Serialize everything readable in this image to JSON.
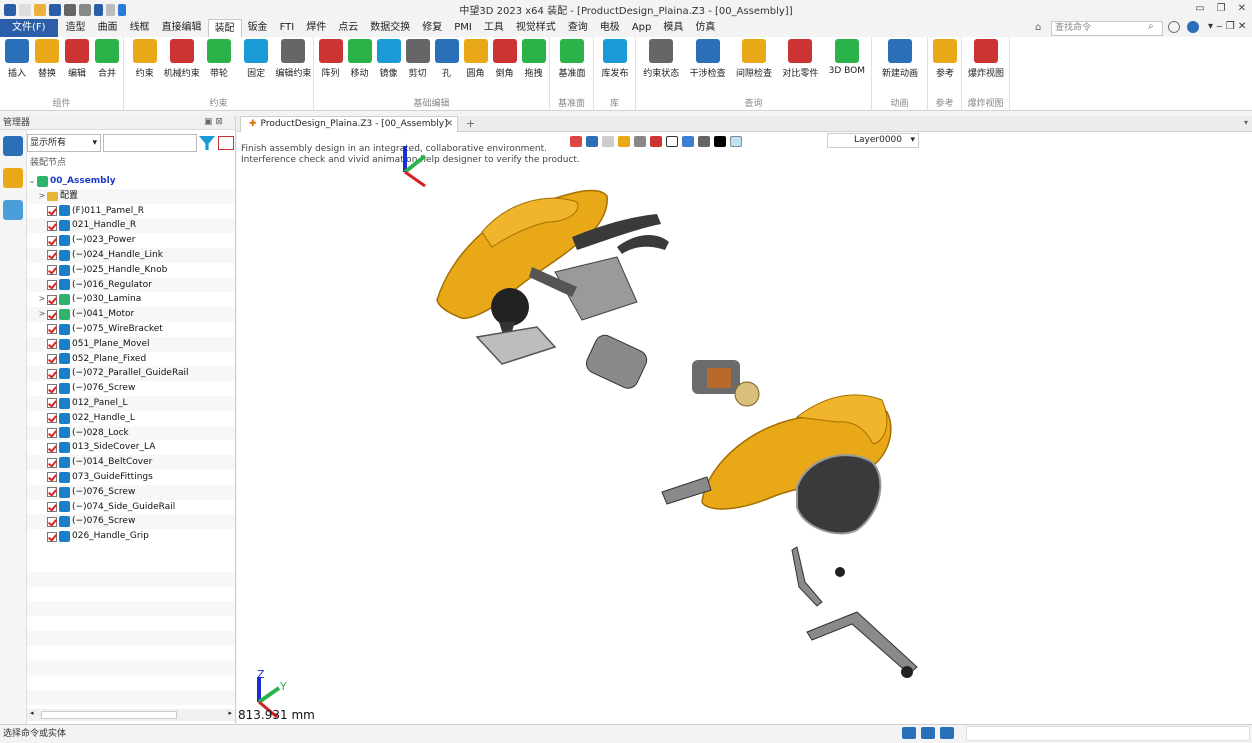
{
  "window": {
    "title": "中望3D 2023 x64          装配 - [ProductDesign_Plaina.Z3 - [00_Assembly]]"
  },
  "menubar": {
    "file": "文件(F)",
    "items": [
      "造型",
      "曲面",
      "线框",
      "直接编辑",
      "装配",
      "钣金",
      "FTI",
      "焊件",
      "点云",
      "数据交换",
      "修复",
      "PMI",
      "工具",
      "视觉样式",
      "查询",
      "电极",
      "App",
      "模具",
      "仿真"
    ],
    "active_index": 4,
    "search_placeholder": "查找命令"
  },
  "ribbon": {
    "groups": [
      {
        "label": "组件",
        "buttons": [
          "插入",
          "替换",
          "编辑",
          "合并"
        ]
      },
      {
        "label": "约束",
        "buttons": [
          "约束",
          "机械约束",
          "带轮",
          "固定",
          "编辑约束"
        ]
      },
      {
        "label": "基础编辑",
        "buttons": [
          "阵列",
          "移动",
          "镜像",
          "剪切",
          "孔",
          "圆角",
          "倒角",
          "拖拽"
        ]
      },
      {
        "label": "基准面",
        "buttons": [
          "基准面"
        ]
      },
      {
        "label": "库",
        "buttons": [
          "库发布"
        ]
      },
      {
        "label": "查询",
        "buttons": [
          "约束状态",
          "干涉检查",
          "间隙检查",
          "对比零件",
          "3D BOM"
        ]
      },
      {
        "label": "动画",
        "buttons": [
          "新建动画"
        ]
      },
      {
        "label": "参考",
        "buttons": [
          "参考"
        ]
      },
      {
        "label": "爆炸视图",
        "buttons": [
          "爆炸视图"
        ]
      }
    ]
  },
  "manager": {
    "title": "管理器",
    "filter_value": "显示所有",
    "tree_header": "装配节点",
    "root": "00_Assembly",
    "items": [
      {
        "label": "配置",
        "kind": "folder",
        "expander": ">"
      },
      {
        "label": "(F)011_Pamel_R",
        "kind": "part"
      },
      {
        "label": "021_Handle_R",
        "kind": "part"
      },
      {
        "label": "(−)023_Power",
        "kind": "part"
      },
      {
        "label": "(−)024_Handle_Link",
        "kind": "part"
      },
      {
        "label": "(−)025_Handle_Knob",
        "kind": "part"
      },
      {
        "label": "(−)016_Regulator",
        "kind": "part"
      },
      {
        "label": "(−)030_Lamina",
        "kind": "asm",
        "expander": ">"
      },
      {
        "label": "(−)041_Motor",
        "kind": "asm",
        "expander": ">"
      },
      {
        "label": "(−)075_WireBracket",
        "kind": "part"
      },
      {
        "label": "051_Plane_Movel",
        "kind": "part"
      },
      {
        "label": "052_Plane_Fixed",
        "kind": "part"
      },
      {
        "label": "(−)072_Parallel_GuideRail",
        "kind": "part"
      },
      {
        "label": "(−)076_Screw",
        "kind": "part"
      },
      {
        "label": "012_Panel_L",
        "kind": "part"
      },
      {
        "label": "022_Handle_L",
        "kind": "part"
      },
      {
        "label": "(−)028_Lock",
        "kind": "part"
      },
      {
        "label": "013_SideCover_LA",
        "kind": "part"
      },
      {
        "label": "(−)014_BeltCover",
        "kind": "part"
      },
      {
        "label": "073_GuideFittings",
        "kind": "part"
      },
      {
        "label": "(−)076_Screw",
        "kind": "part"
      },
      {
        "label": "(−)074_Side_GuideRail",
        "kind": "part"
      },
      {
        "label": "(−)076_Screw",
        "kind": "part"
      },
      {
        "label": "026_Handle_Grip",
        "kind": "part"
      }
    ]
  },
  "document": {
    "tab_label": "ProductDesign_Plaina.Z3 - [00_Assembly]",
    "hint_line1": "Finish assembly design in an integrated, collaborative environment.",
    "hint_line2": "Interference check and vivid animation help designer to verify the product.",
    "layer": "Layer0000",
    "coord_readout": "813.931 mm",
    "axis_z": "Z",
    "axis_y": "Y"
  },
  "status": {
    "text": "选择命令或实体"
  },
  "colors": {
    "accent": "#2a5ea8",
    "part_yellow": "#e9a817",
    "dark_gray": "#3a3a3a"
  }
}
